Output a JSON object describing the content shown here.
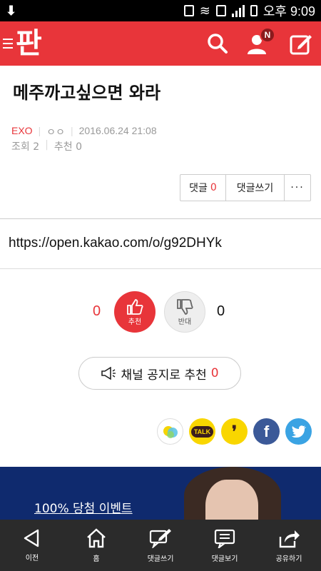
{
  "status_bar": {
    "time_label": "오후 9:09"
  },
  "app": {
    "logo_text": "판",
    "brand_color": "#e8353a",
    "notification_badge": "N"
  },
  "post": {
    "title": "메주까고싶으면 와라",
    "category": "EXO",
    "author": "ㅇㅇ",
    "date": "2016.06.24 21:08",
    "views_label": "조회",
    "views": "2",
    "recommend_label": "추천",
    "recommend": "0",
    "body_text": "https://open.kakao.com/o/g92DHYk"
  },
  "actions": {
    "comment_label": "댓글",
    "comment_count": "0",
    "write_comment_label": "댓글쓰기",
    "more_label": "···"
  },
  "vote": {
    "up_count": "0",
    "up_label": "추천",
    "down_count": "0",
    "down_label": "반대"
  },
  "notice": {
    "label": "채널 공지로 추천",
    "count": "0"
  },
  "share": {
    "kakaotalk_label": "TALK"
  },
  "ad": {
    "text": "100% 당첨 이벤트"
  },
  "bottom_nav": {
    "items": [
      {
        "label": "이전",
        "icon": "back-icon"
      },
      {
        "label": "홈",
        "icon": "home-icon"
      },
      {
        "label": "댓글쓰기",
        "icon": "write-icon"
      },
      {
        "label": "댓글보기",
        "icon": "comment-view-icon"
      },
      {
        "label": "공유하기",
        "icon": "share-icon"
      }
    ]
  }
}
